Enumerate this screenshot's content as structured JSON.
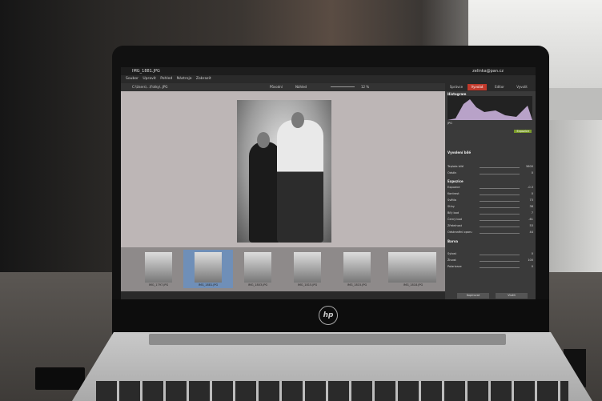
{
  "app": {
    "title": "IMG_1881.JPG",
    "account": "zelinka@pan.cz",
    "menu": [
      "Soubor",
      "Upravit",
      "Pohled",
      "Nástroje",
      "Zobrazit"
    ],
    "tabs": [
      "Správce",
      "Vyvolat",
      "Editor",
      "Vyvolit"
    ],
    "active_tab": "Vyvolat",
    "toolbar": {
      "path": "C:\\Users\\...\\Fotky\\..JPG",
      "mode": "Původní",
      "compare": "Náhled",
      "zoom": "12 %"
    },
    "filmstrip": [
      {
        "label": "IMG_1797.JPG",
        "selected": false
      },
      {
        "label": "IMG_1881.JPG",
        "selected": true
      },
      {
        "label": "IMG_1803.JPG",
        "selected": false
      },
      {
        "label": "IMG_1815.JPG",
        "selected": false
      },
      {
        "label": "IMG_1815.JPG",
        "selected": false
      },
      {
        "label": "IMG_1818.JPG",
        "selected": false
      }
    ],
    "panel": {
      "histogram_label": "Histogram",
      "file_info": "JPG",
      "zone": "Expozice",
      "sections": {
        "wb": "Vyvolení bílé",
        "exposure": "Expozice",
        "color": "Barva"
      },
      "wb_rows": [
        {
          "name": "Teplota bílé",
          "val": "5600"
        },
        {
          "name": "Odstín",
          "val": "0"
        }
      ],
      "exp_rows": [
        {
          "name": "Expozice",
          "val": "-0.3"
        },
        {
          "name": "Kontrast",
          "val": "0"
        },
        {
          "name": "Světla",
          "val": "73"
        },
        {
          "name": "Stíny",
          "val": "38"
        },
        {
          "name": "Bílý bod",
          "val": "7"
        },
        {
          "name": "Černý bod",
          "val": "-61"
        },
        {
          "name": "Zřetelnost",
          "val": "53"
        },
        {
          "name": "Odstranění oparu",
          "val": "44"
        }
      ],
      "color_rows": [
        {
          "name": "Sytost",
          "val": "0"
        },
        {
          "name": "Živost",
          "val": "100"
        },
        {
          "name": "Polarizace",
          "val": "0"
        }
      ],
      "copy_button": "Kopírovat",
      "paste_button": "Vložit"
    }
  },
  "device": {
    "brand_logo": "hp"
  }
}
